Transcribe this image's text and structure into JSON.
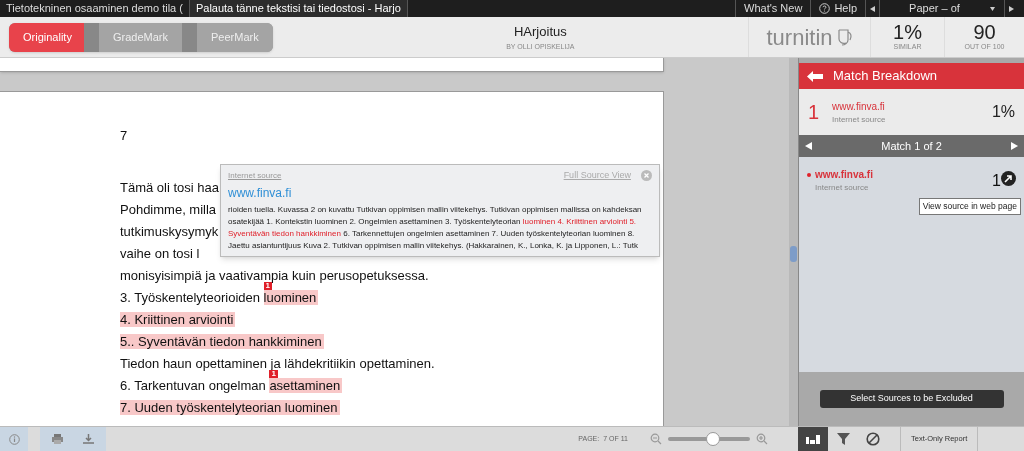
{
  "top_bar": {
    "tabs": [
      {
        "label": "Tietotekninen osaaminen demo tila (",
        "selected": false
      },
      {
        "label": "Palauta tänne tekstisi tai tiedostosi - Harjo",
        "selected": true
      }
    ],
    "whats_new": "What's New",
    "help": "Help",
    "paper_selector": "Paper – of"
  },
  "header": {
    "modes": [
      {
        "label": "Originality",
        "selected": true
      },
      {
        "label": "GradeMark",
        "selected": false
      },
      {
        "label": "PeerMark",
        "selected": false
      }
    ],
    "title": "HArjoitus",
    "byline": "BY OLLI OPISKELIJA",
    "logo": "turnitin",
    "similarity": "1%",
    "similarity_label": "SIMILAR",
    "score": "90",
    "score_label": "OUT OF 100"
  },
  "document": {
    "page_number": "7",
    "lines": [
      {
        "segments": [
          {
            "text": "Tämä oli tosi haa",
            "highlighted": false
          }
        ]
      },
      {
        "segments": [
          {
            "text": "Pohdimme, milla",
            "highlighted": false
          }
        ]
      },
      {
        "segments": [
          {
            "text": "tutkimuskysymyk",
            "highlighted": false
          }
        ]
      },
      {
        "segments": [
          {
            "text": "vaihe on tosi l",
            "highlighted": false
          }
        ]
      },
      {
        "segments": [
          {
            "text": "monisyisimpiä ja vaativampia kuin perusopetuksessa.",
            "highlighted": false
          }
        ]
      },
      {
        "segments": [
          {
            "text": "3. Työskentelyteorioiden ",
            "highlighted": false
          },
          {
            "text": "luominen",
            "highlighted": true,
            "match": "1"
          }
        ]
      },
      {
        "segments": [
          {
            "text": "4. Kriittinen arviointi",
            "highlighted": true
          }
        ]
      },
      {
        "segments": [
          {
            "text": "5.. Syventävän tiedon hankkiminen",
            "highlighted": true
          }
        ]
      },
      {
        "segments": [
          {
            "text": "Tiedon haun opettaminen ja lähdekritiikin opettaminen.",
            "highlighted": false
          }
        ]
      },
      {
        "segments": [
          {
            "text": "6. Tarkentuvan ongelman ",
            "highlighted": false
          },
          {
            "text": "asettaminen",
            "highlighted": true,
            "match": "1"
          }
        ]
      },
      {
        "segments": [
          {
            "text": "7. Uuden työskentelyteorian luominen",
            "highlighted": true
          }
        ]
      }
    ]
  },
  "popup": {
    "label": "Internet source",
    "full_source_link": "Full Source View",
    "source": "www.finva.fi",
    "excerpt": "rioiden tuella. Kuvassa 2 on kuvattu Tutkivan oppimisen mallin viitekehys. Tutkivan oppimisen mallissa on kahdeksan osatekijää 1. Kontekstin luominen 2. Ongelmien asettaminen 3. Työskentelyteorian **luominen 4. Kriittinen arviointi 5. Syventävän tiedon hankkiminen** 6. Tarkennettujen ongelmien asettaminen 7. Uuden työskentelyteorian luominen 8. Jaettu asiantuntijuus Kuva 2. Tutkivan oppimisen mallin viitekehys. (Hakkarainen, K., Lonka, K. ja Lipponen, L.: Tutk"
  },
  "panel": {
    "title": "Match Breakdown",
    "source": {
      "number": "1",
      "name": "www.finva.fi",
      "type": "Internet source",
      "percent": "1%"
    },
    "match_nav": "Match 1 of 2",
    "match": {
      "name": "www.finva.fi",
      "type": "Internet source",
      "percent": "1",
      "color": "#e0202a"
    },
    "tooltip": "View source in web page",
    "exclude_button": "Select Sources to be Excluded"
  },
  "bottom_bar": {
    "page_label": "PAGE:",
    "page": "7 OF 11",
    "zoom": {
      "level": 0.55
    },
    "panel_tabs": [
      {
        "kind": "breakdown",
        "selected": true
      },
      {
        "kind": "filter",
        "selected": false
      },
      {
        "kind": "exclude",
        "selected": false
      }
    ],
    "text_only_button": "Text-Only Report"
  }
}
